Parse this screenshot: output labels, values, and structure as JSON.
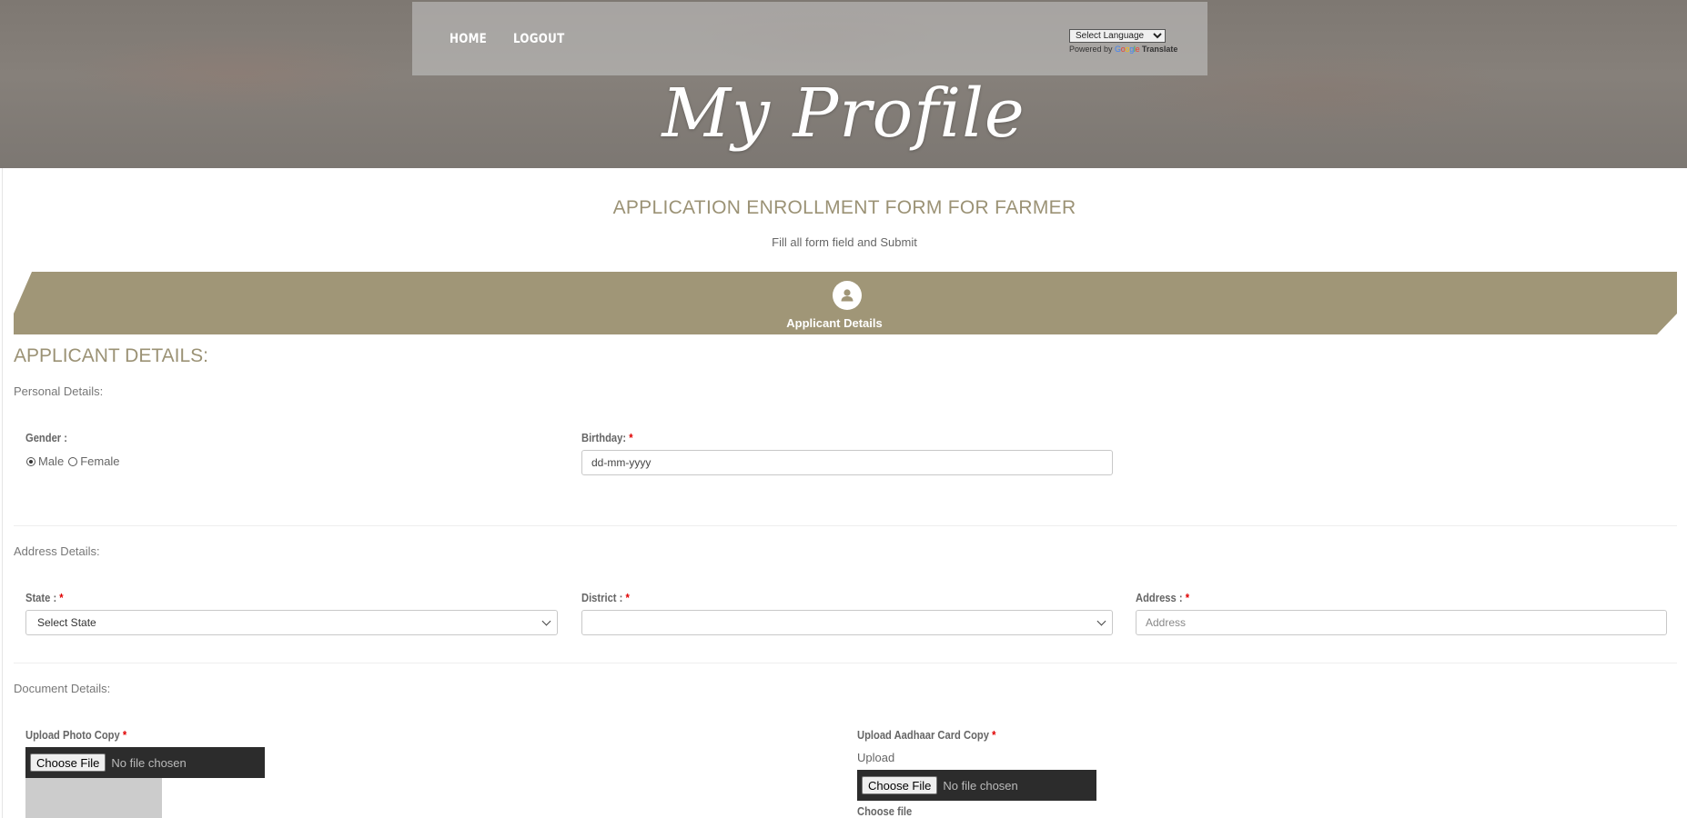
{
  "nav": {
    "home": "HOME",
    "logout": "LOGOUT",
    "language_select": "Select Language",
    "powered_by": "Powered by",
    "google": "Google",
    "translate": "Translate"
  },
  "hero": {
    "title": "My Profile"
  },
  "form": {
    "title": "APPLICATION ENROLLMENT FORM FOR FARMER",
    "subtitle": "Fill all form field and Submit",
    "step_label": "Applicant Details",
    "section_heading": "APPLICANT DETAILS:"
  },
  "personal": {
    "group_label": "Personal Details:",
    "gender_label": "Gender :",
    "gender_options": [
      "Male",
      "Female"
    ],
    "gender_selected": "Male",
    "birthday_label": "Birthday:",
    "birthday_value": "dd-mm-yyyy"
  },
  "address": {
    "group_label": "Address Details:",
    "state_label": "State :",
    "state_value": "Select State",
    "district_label": "District :",
    "district_value": "",
    "address_label": "Address :",
    "address_placeholder": "Address"
  },
  "documents": {
    "group_label": "Document Details:",
    "photo_label": "Upload Photo Copy",
    "photo_button": "Choose File",
    "photo_status": "No file chosen",
    "aadhaar_label": "Upload Aadhaar Card Copy",
    "aadhaar_upload_text": "Upload",
    "aadhaar_button": "Choose File",
    "aadhaar_status": "No file chosen",
    "choose_file_label": "Choose file"
  },
  "required_mark": "*",
  "colors": {
    "accent": "#9b9275",
    "band": "#a09677",
    "required": "#e00000"
  }
}
